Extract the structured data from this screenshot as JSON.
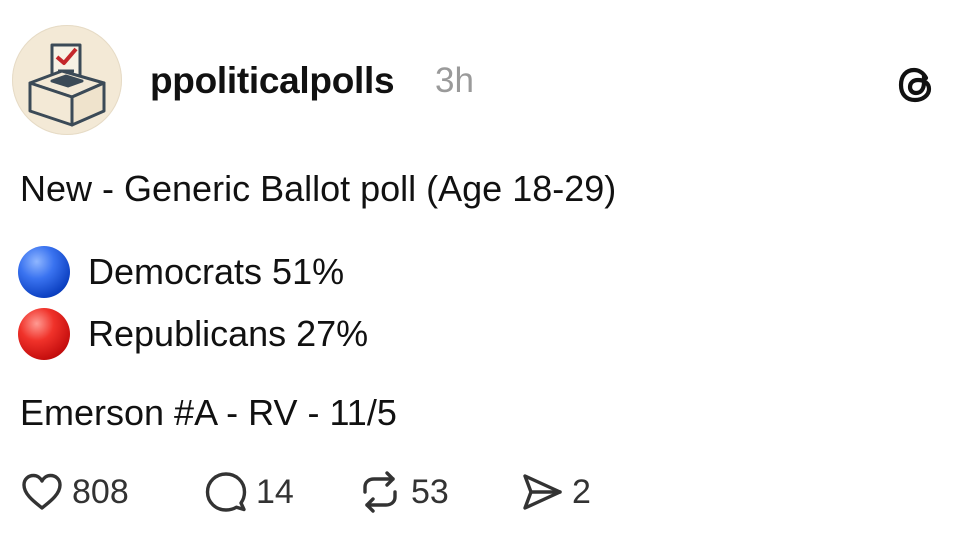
{
  "post": {
    "username": "ppoliticalpolls",
    "timestamp": "3h",
    "headline": "New - Generic Ballot poll (Age 18-29)",
    "results": [
      {
        "label": "Democrats 51%",
        "color": "#1f5bd6",
        "marker": "blue-circle"
      },
      {
        "label": "Republicans 27%",
        "color": "#e0201b",
        "marker": "red-circle"
      }
    ],
    "source": "Emerson #A - RV - 11/5"
  },
  "actions": {
    "likes": "808",
    "replies": "14",
    "reposts": "53",
    "shares": "2"
  },
  "icons": {
    "avatar": "ballot-box-icon",
    "app": "threads-logo-icon",
    "like": "heart-icon",
    "reply": "comment-bubble-icon",
    "repost": "repost-icon",
    "share": "send-icon"
  }
}
